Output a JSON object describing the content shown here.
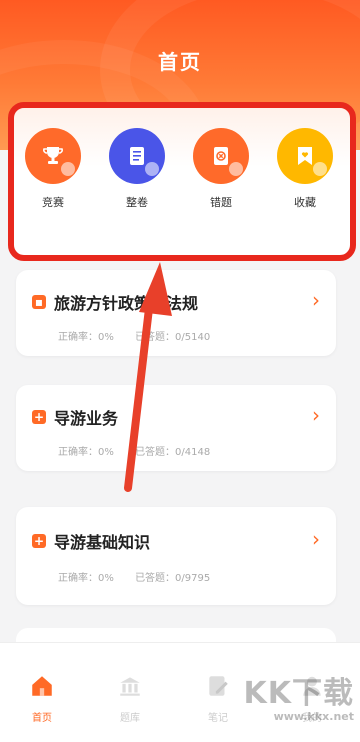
{
  "header": {
    "title": "首页"
  },
  "shortcuts": [
    {
      "label": "竞赛",
      "icon": "trophy-icon",
      "color": "#ff6a2a"
    },
    {
      "label": "整卷",
      "icon": "exam-paper-icon",
      "color": "#4a55e8"
    },
    {
      "label": "错题",
      "icon": "wrong-question-icon",
      "color": "#ff6a2a"
    },
    {
      "label": "收藏",
      "icon": "favorite-icon",
      "color": "#ffb800"
    }
  ],
  "categories": [
    {
      "title": "旅游方针政策和法规",
      "accuracy_label": "正确率：0%",
      "answered_label": "已答题：0/5140"
    },
    {
      "title": "导游业务",
      "accuracy_label": "正确率：0%",
      "answered_label": "已答题：0/4148"
    },
    {
      "title": "导游基础知识",
      "accuracy_label": "正确率：0%",
      "answered_label": "已答题：0/9795"
    }
  ],
  "tabbar": [
    {
      "label": "首页",
      "icon": "home-icon",
      "active": true
    },
    {
      "label": "题库",
      "icon": "question-bank-icon",
      "active": false
    },
    {
      "label": "笔记",
      "icon": "notes-icon",
      "active": false
    },
    {
      "label": "我的",
      "icon": "profile-icon",
      "active": false
    }
  ],
  "watermark": {
    "brand": "KK下载",
    "url": "www.kkx.net"
  },
  "colors": {
    "accent": "#ff6a26",
    "highlight_border": "#e8281d",
    "arrow": "#e8402a"
  }
}
